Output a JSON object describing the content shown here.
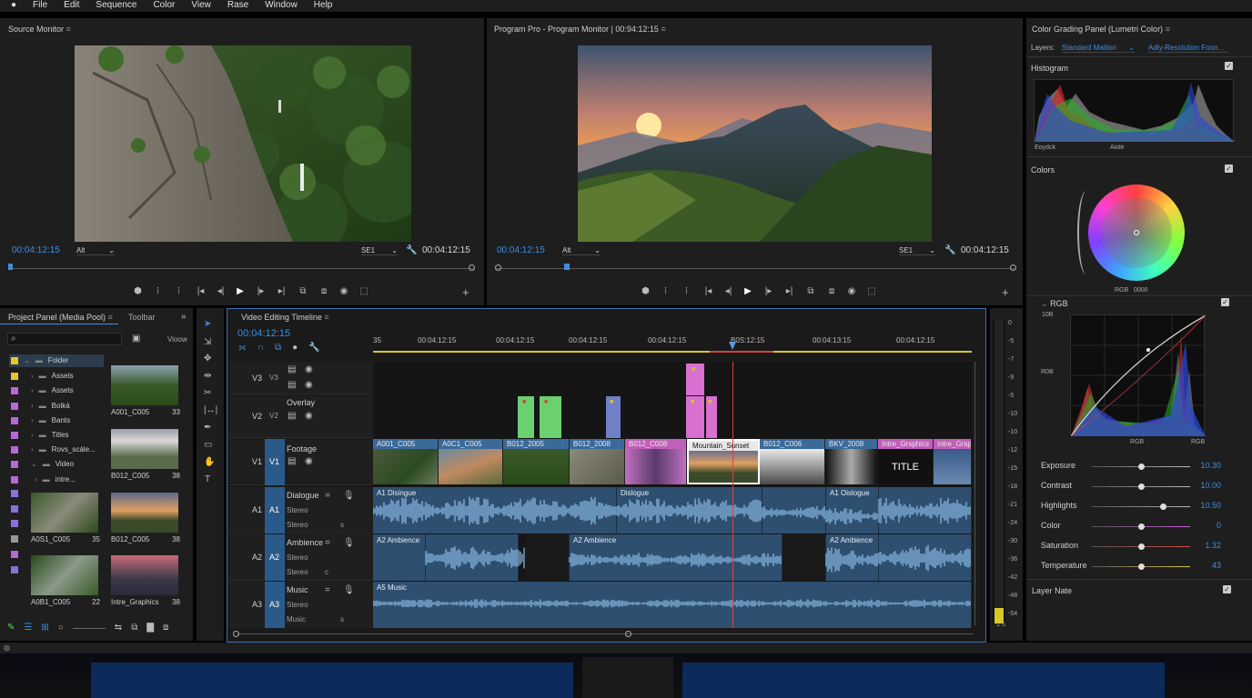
{
  "menu": [
    "File",
    "Edit",
    "Sequence",
    "Color",
    "View",
    "Rase",
    "Window",
    "Help"
  ],
  "source": {
    "title": "Source Monitor",
    "tc_left": "00:04:12:15",
    "tc_right": "00:04:12:15",
    "dd_left": "Alt",
    "dd_right": "SE1"
  },
  "program": {
    "title": "Program Pro - Program Monitor | 00:94:12:15",
    "tc_left": "00:04:12:15",
    "tc_right": "00:04:12:15",
    "dd_left": "Alt",
    "dd_right": "SE1"
  },
  "transport_icons": [
    "marker-icon",
    "mark-in-icon",
    "mark-out-icon",
    "go-to-in-icon",
    "step-back-icon",
    "play-icon",
    "step-forward-icon",
    "go-to-out-icon",
    "insert-icon",
    "overwrite-icon",
    "export-frame-icon",
    "compare-icon"
  ],
  "transport_glyphs": [
    "⬢",
    "⦙",
    "⦙",
    "|◂",
    "◂|",
    "▶",
    "|▸",
    "▸|",
    "⧉",
    "⧈",
    "◉",
    "⬚"
  ],
  "project": {
    "title": "Project Panel (Media Pool)",
    "tab2": "Toolbar",
    "search_placeholder": "",
    "view_label": "Vioow",
    "folders": [
      {
        "name": "Folder",
        "color": "#e6c629"
      },
      {
        "name": "Assets",
        "color": "#e6c629"
      },
      {
        "name": "Assets",
        "color": "#b668d8"
      },
      {
        "name": "Bolká",
        "color": "#b668d8"
      },
      {
        "name": "Bants",
        "color": "#b668d8"
      },
      {
        "name": "Titles",
        "color": "#b668d8"
      },
      {
        "name": "Rovs_scále...",
        "color": "#b668d8"
      },
      {
        "name": "Video",
        "color": "#b668d8"
      },
      {
        "name": "intre...",
        "color": "#b668d8"
      },
      {
        "name": "",
        "color": "#8a70d8"
      },
      {
        "name": "",
        "color": "#8a70d8"
      },
      {
        "name": "",
        "color": "#8a70d8"
      },
      {
        "name": "",
        "color": "#999999"
      },
      {
        "name": "",
        "color": "#b668d8"
      },
      {
        "name": "",
        "color": "#8a70d8"
      }
    ],
    "bins": [
      {
        "name": "A001_C005",
        "num": "33"
      },
      {
        "name": "B012_C005",
        "num": "38"
      },
      {
        "name": "A0S1_C005",
        "num": "35"
      },
      {
        "name": "B012_C005",
        "num": "38"
      },
      {
        "name": "A0B1_C005",
        "num": "22"
      },
      {
        "name": "Intre_Graphics",
        "num": "38"
      }
    ]
  },
  "timeline": {
    "title": "Video Editing Timeline",
    "tc": "00:04:12:15",
    "ruler": [
      "35",
      "00:04:12:15",
      "00:04:12:15",
      "00:04:12:15",
      "00:04:12:15",
      "B0S:12:15",
      "00:04:13:15",
      "00:04:12:15"
    ],
    "tracks": {
      "v3": "V3",
      "v2": "V2",
      "v1": "V1",
      "v2_name": "Overlay",
      "v1_name": "Footage",
      "a1": "A1",
      "a2": "A2",
      "a3": "A3",
      "a1_name": "Dialogue",
      "a2_name": "Ambience",
      "a3_name": "Music",
      "stereo": "Stereo"
    },
    "v1_clips": [
      "A001_C005",
      "A0C1_C005",
      "B012_2005",
      "B012_2008",
      "B012_C008",
      "Mountain_Sunset",
      "B012_C006",
      "BKV_2008",
      "Intre_Grsphics",
      "Intre_Grsp"
    ],
    "title_card": "TITLE",
    "a1_clips": [
      "A1 Disingue",
      "Dislogue",
      "A1 Oislogue"
    ],
    "a2_clips": [
      "A2 Ambience",
      "A2 Ambience",
      "A2 Ambience"
    ],
    "a3_clips": [
      "A5 Music"
    ]
  },
  "meter": [
    "0",
    "-5",
    "-7",
    "-9",
    "-5",
    "-10",
    "-10",
    "-12",
    "-15",
    "-18",
    "-21",
    "-24",
    "-30",
    "-36",
    "-42",
    "-48",
    "-54"
  ],
  "meter_bottom": "1 5",
  "color": {
    "title": "Color Grading Panel (Lumetri Color)",
    "layers_label": "Layers:",
    "layers_value": "Standard Mailion",
    "layers_value2": "Adly-Resolution Foon...",
    "histogram": "Histogram",
    "hist_l": "Eoydck",
    "hist_c": "Aiole",
    "colors": "Colors",
    "wheel_l": "RGB",
    "wheel_r": "0000",
    "rgb": "RGB",
    "curve_top": "10B",
    "curve_mid": "R0B",
    "curve_b1": "RGB",
    "curve_b2": "RGB",
    "sliders": [
      {
        "label": "Exposure",
        "value": "10.30",
        "pos": 0.5,
        "color": "#bbbbbb"
      },
      {
        "label": "Contrast",
        "value": "10.00",
        "pos": 0.5,
        "color": "#bbbbbb"
      },
      {
        "label": "Highlights",
        "value": "10.50",
        "pos": 0.72,
        "color": "#bbbbbb"
      },
      {
        "label": "Color",
        "value": "0",
        "pos": 0.5,
        "color": "#c85ad8"
      },
      {
        "label": "Saturation",
        "value": "1.32",
        "pos": 0.5,
        "color": "#d84a4a"
      },
      {
        "label": "Temperature",
        "value": "43",
        "pos": 0.5,
        "color": "#d8c84a"
      }
    ],
    "layer_note": "Layer Nate"
  }
}
